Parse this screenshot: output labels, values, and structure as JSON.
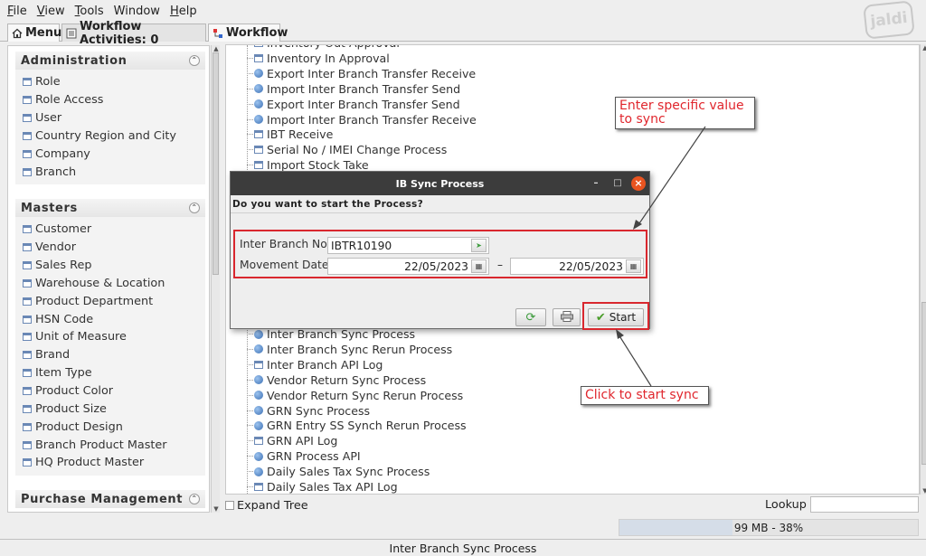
{
  "menubar": {
    "items": [
      {
        "first": "F",
        "rest": "ile"
      },
      {
        "first": "V",
        "rest": "iew"
      },
      {
        "first": "T",
        "rest": "ools"
      },
      {
        "first": "",
        "rest": "Window"
      },
      {
        "first": "H",
        "rest": "elp"
      }
    ],
    "logo_text": "jaldi"
  },
  "tabs": {
    "menu": "Menu",
    "workflow_activities": "Workflow Activities: 0",
    "workflow": "Workflow"
  },
  "sidebar": {
    "sections": [
      {
        "title": "Administration",
        "items": [
          "Role",
          "Role Access",
          "User",
          "Country Region and City",
          "Company",
          "Branch"
        ]
      },
      {
        "title": "Masters",
        "items": [
          "Customer",
          "Vendor",
          "Sales Rep",
          "Warehouse & Location",
          "Product Department",
          "HSN Code",
          "Unit of Measure",
          "Brand",
          "Item Type",
          "Product Color",
          "Product Size",
          "Product Design",
          "Branch Product Master",
          "HQ Product Master"
        ]
      },
      {
        "title": "Purchase Management",
        "items": []
      }
    ]
  },
  "tree": {
    "top_nodes": [
      {
        "label": "Inventory Out Approval",
        "icon": "window-icon"
      },
      {
        "label": "Inventory In Approval",
        "icon": "window-icon"
      },
      {
        "label": "Export Inter Branch Transfer Receive",
        "icon": "globe-icon"
      },
      {
        "label": "Import Inter Branch Transfer Send",
        "icon": "globe-icon"
      },
      {
        "label": "Export Inter Branch Transfer Send",
        "icon": "globe-icon"
      },
      {
        "label": "Import Inter Branch Transfer Receive",
        "icon": "globe-icon"
      },
      {
        "label": "IBT Receive",
        "icon": "window-icon"
      },
      {
        "label": "Serial No / IMEI Change Process",
        "icon": "window-icon"
      },
      {
        "label": "Import Stock Take",
        "icon": "window-icon"
      }
    ],
    "bottom_nodes": [
      {
        "label": "Inter Branch Sync Process",
        "icon": "globe-icon"
      },
      {
        "label": "Inter Branch Sync Rerun Process",
        "icon": "globe-icon"
      },
      {
        "label": "Inter Branch API Log",
        "icon": "window-icon"
      },
      {
        "label": "Vendor Return Sync Process",
        "icon": "globe-icon"
      },
      {
        "label": "Vendor Return Sync Rerun Process",
        "icon": "globe-icon"
      },
      {
        "label": "GRN Sync Process",
        "icon": "globe-icon"
      },
      {
        "label": "GRN Entry SS Synch Rerun Process",
        "icon": "globe-icon"
      },
      {
        "label": "GRN API Log",
        "icon": "window-icon"
      },
      {
        "label": "GRN Process API",
        "icon": "globe-icon"
      },
      {
        "label": "Daily Sales Tax Sync Process",
        "icon": "globe-icon"
      },
      {
        "label": "Daily Sales Tax API Log",
        "icon": "window-icon"
      }
    ]
  },
  "footer": {
    "expand_tree": "Expand Tree",
    "lookup_label": "Lookup",
    "memory": "99 MB - 38%",
    "memory_fraction": 0.38,
    "status": "Inter Branch Sync Process"
  },
  "dialog": {
    "title": "IB Sync Process",
    "question": "Do you want to start the Process?",
    "inter_branch_label": "Inter Branch No",
    "inter_branch_value": "IBTR10190",
    "movement_date_label": "Movement Date",
    "date_from": "22/05/2023",
    "date_to": "22/05/2023",
    "date_separator": "–",
    "start_label": "Start"
  },
  "annotations": {
    "callout_value": "Enter specific value\nto sync",
    "callout_start": "Click to start sync",
    "highlight_color": "#d9272e"
  }
}
